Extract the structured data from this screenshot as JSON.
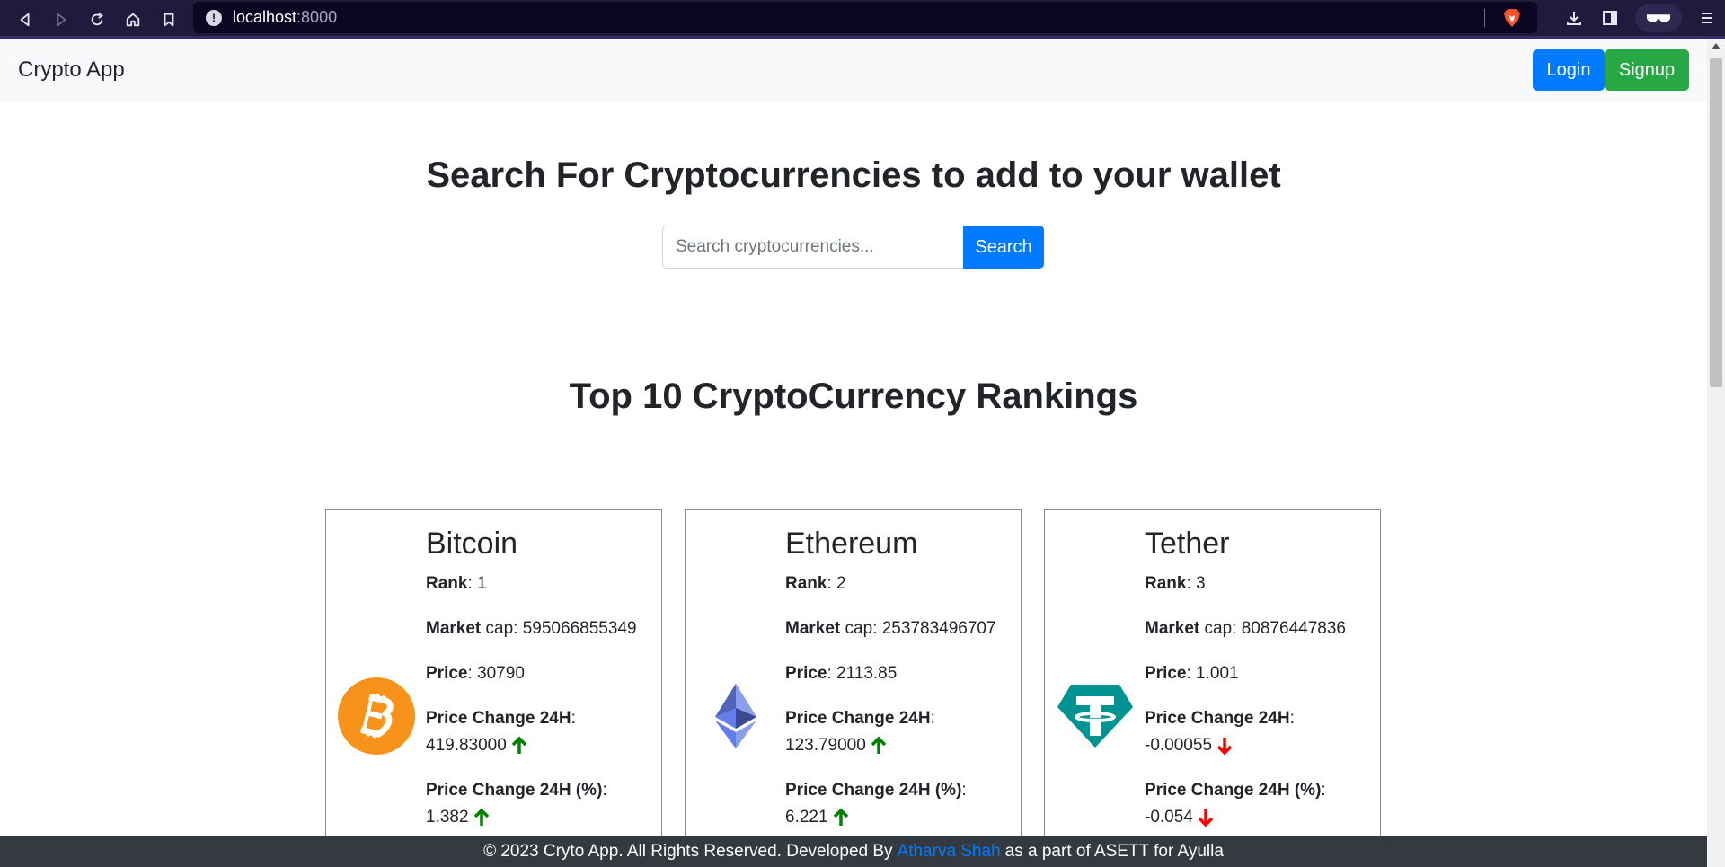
{
  "browser": {
    "url_host": "localhost",
    "url_port": ":8000"
  },
  "navbar": {
    "brand": "Crypto App",
    "login_label": "Login",
    "signup_label": "Signup"
  },
  "hero": {
    "title": "Search For Cryptocurrencies to add to your wallet",
    "search_placeholder": "Search cryptocurrencies...",
    "search_button": "Search"
  },
  "rankings": {
    "title": "Top 10 CryptoCurrency Rankings",
    "labels": {
      "rank": "Rank",
      "market": "Market",
      "cap": " cap: ",
      "price": "Price",
      "change": "Price Change 24H",
      "change_pct": "Price Change 24H (%)"
    },
    "cards": [
      {
        "name": "Bitcoin",
        "rank": "1",
        "market_cap": "595066855349",
        "price": "30790",
        "change": "419.83000",
        "change_pct": "1.382",
        "trend": "up",
        "logo_color": "#f7931a"
      },
      {
        "name": "Ethereum",
        "rank": "2",
        "market_cap": "253783496707",
        "price": "2113.85",
        "change": "123.79000",
        "change_pct": "6.221",
        "trend": "up",
        "logo_color": "#627eea"
      },
      {
        "name": "Tether",
        "rank": "3",
        "market_cap": "80876447836",
        "price": "1.001",
        "change": "-0.00055",
        "change_pct": "-0.054",
        "trend": "down",
        "logo_color": "#009393"
      }
    ]
  },
  "footer": {
    "prefix": "© 2023 Cryto App. All Rights Reserved. Developed By",
    "author": "Atharva Shah",
    "suffix": "as a part of ASETT for Ayulla"
  },
  "colors": {
    "up": "#008000",
    "down": "#ff0000",
    "primary": "#007bff",
    "success": "#28a745"
  }
}
